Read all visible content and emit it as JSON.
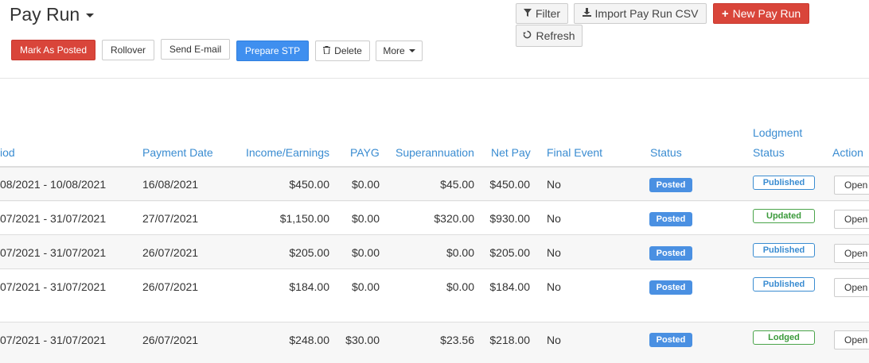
{
  "page": {
    "title": "Pay Run"
  },
  "toolbar": {
    "mark_as_posted": "Mark As Posted",
    "rollover": "Rollover",
    "send_email": "Send E-mail",
    "prepare_stp": "Prepare STP",
    "delete": "Delete",
    "more": "More"
  },
  "top_actions": {
    "filter": "Filter",
    "import_csv": "Import Pay Run CSV",
    "new_pay_run": "New Pay Run",
    "refresh": "Refresh"
  },
  "table": {
    "headers": {
      "period": "iod",
      "payment_date": "Payment Date",
      "income": "Income/Earnings",
      "payg": "PAYG",
      "super": "Superannuation",
      "net_pay": "Net Pay",
      "final_event": "Final Event",
      "status": "Status",
      "lodgment_1": "Lodgment",
      "lodgment_2": "Status",
      "action": "Action"
    },
    "rows": [
      {
        "period": "08/2021 - 10/08/2021",
        "payment_date": "16/08/2021",
        "income": "$450.00",
        "payg": "$0.00",
        "super": "$45.00",
        "net_pay": "$450.00",
        "final_event": "No",
        "status": "Posted",
        "lodgment": "Published",
        "action": "Open"
      },
      {
        "period": "07/2021 - 31/07/2021",
        "payment_date": "27/07/2021",
        "income": "$1,150.00",
        "payg": "$0.00",
        "super": "$320.00",
        "net_pay": "$930.00",
        "final_event": "No",
        "status": "Posted",
        "lodgment": "Updated",
        "action": "Open"
      },
      {
        "period": "07/2021 - 31/07/2021",
        "payment_date": "26/07/2021",
        "income": "$205.00",
        "payg": "$0.00",
        "super": "$0.00",
        "net_pay": "$205.00",
        "final_event": "No",
        "status": "Posted",
        "lodgment": "Published",
        "action": "Open"
      },
      {
        "period": "07/2021 - 31/07/2021",
        "payment_date": "26/07/2021",
        "income": "$184.00",
        "payg": "$0.00",
        "super": "$0.00",
        "net_pay": "$184.00",
        "final_event": "No",
        "status": "Posted",
        "lodgment": "Published",
        "action": "Open"
      },
      {
        "period": "07/2021 - 31/07/2021",
        "payment_date": "26/07/2021",
        "income": "$248.00",
        "payg": "$30.00",
        "super": "$23.56",
        "net_pay": "$218.00",
        "final_event": "No",
        "status": "Posted",
        "lodgment": "Lodged",
        "action": "Open"
      }
    ]
  },
  "icons": {
    "filter": "filter-icon",
    "import": "download-icon",
    "new": "plus-icon",
    "refresh": "refresh-icon",
    "delete": "trash-icon"
  },
  "colors": {
    "link_blue": "#3a8cd1",
    "danger": "#d9453a",
    "primary": "#3f8fef",
    "posted_badge": "#4a90e2",
    "lodged_green": "#4aa44a"
  }
}
